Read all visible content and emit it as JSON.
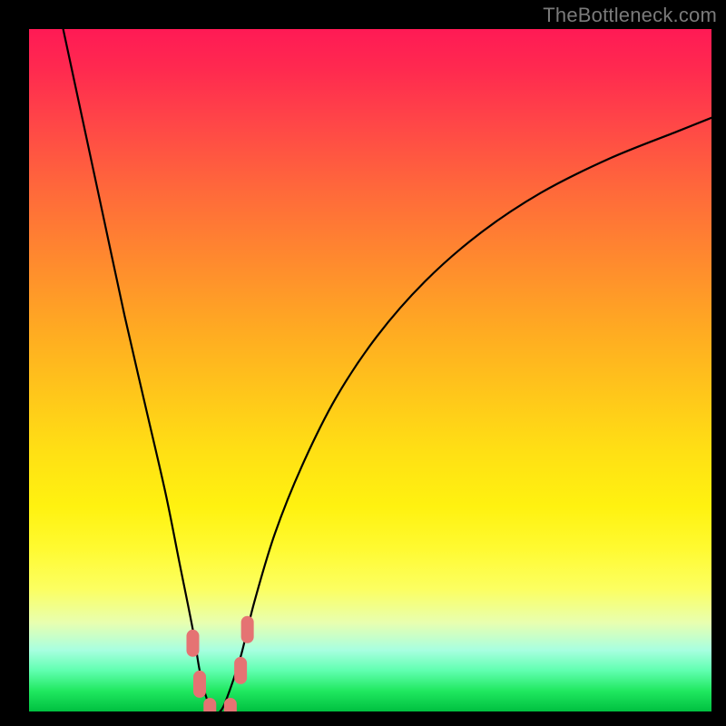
{
  "watermark": "TheBottleneck.com",
  "chart_data": {
    "type": "line",
    "title": "",
    "xlabel": "",
    "ylabel": "",
    "xlim": [
      0,
      100
    ],
    "ylim": [
      0,
      100
    ],
    "grid": false,
    "legend": false,
    "series": [
      {
        "name": "bottleneck-curve",
        "x": [
          5,
          8,
          11,
          14,
          17,
          20,
          22,
          24,
          25,
          26,
          27,
          28,
          29,
          31,
          33,
          36,
          40,
          45,
          51,
          58,
          66,
          75,
          85,
          95,
          100
        ],
        "values": [
          100,
          86,
          72,
          58,
          45,
          32,
          22,
          12,
          6,
          2,
          0,
          0,
          2,
          8,
          16,
          26,
          36,
          46,
          55,
          63,
          70,
          76,
          81,
          85,
          87
        ]
      }
    ],
    "markers": [
      {
        "name": "marker-left-upper",
        "x": 24.0,
        "y": 10
      },
      {
        "name": "marker-left-lower",
        "x": 25.0,
        "y": 4
      },
      {
        "name": "marker-bottom-left",
        "x": 26.5,
        "y": 0
      },
      {
        "name": "marker-bottom-right",
        "x": 29.5,
        "y": 0
      },
      {
        "name": "marker-right-lower",
        "x": 31.0,
        "y": 6
      },
      {
        "name": "marker-right-upper",
        "x": 32.0,
        "y": 12
      }
    ],
    "marker_color": "#e57373"
  }
}
